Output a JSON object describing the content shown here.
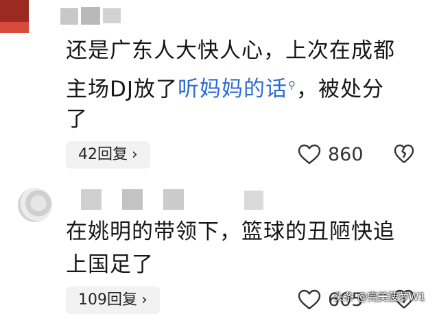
{
  "comments": [
    {
      "text_before": "还是广东人大快人心，上次在成都",
      "text_line2_before": "主场DJ放了",
      "keyword": "听妈妈的话",
      "text_line2_after": "，被处分",
      "text_line3": "了",
      "replies_label": "42回复",
      "likes": "860"
    },
    {
      "line1": "在姚明的带领下，篮球的丑陋快追",
      "line2": "上国足了",
      "replies_label": "109回复",
      "likes": "605"
    }
  ],
  "watermark": "头条 @完美菠萝W1",
  "icons": {
    "reply_chevron": "chevron-right-icon",
    "like": "heart-outline-icon",
    "dislike": "broken-heart-icon",
    "keyword_search": "search-icon"
  },
  "colors": {
    "keyword": "#2b6cd4",
    "avatar_red": "#9b2a22"
  }
}
